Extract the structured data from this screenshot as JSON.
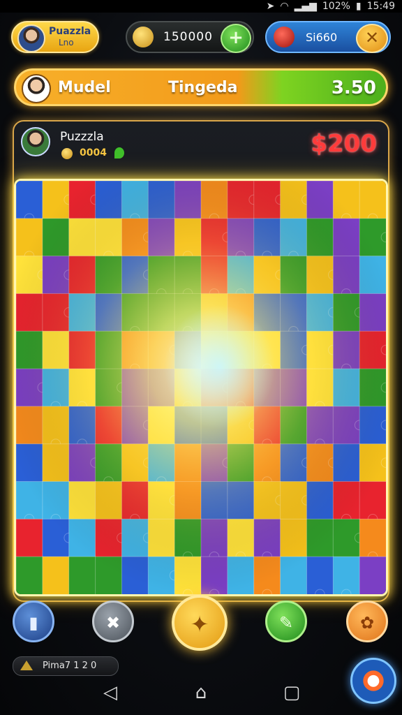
{
  "status_bar": {
    "icons": [
      "navigation-arrow-icon",
      "wifi-icon",
      "signal-icon"
    ],
    "battery": "102%",
    "time": "15:49"
  },
  "hud": {
    "profile": {
      "name": "Puazzla",
      "level": "Lno"
    },
    "coins": {
      "value": "150000",
      "add_label": "+"
    },
    "gems": {
      "value": "Si660",
      "close_label": "✕"
    }
  },
  "opponent_bar": {
    "name": "Mudel",
    "center_label": "Tingeda",
    "score": "3.50"
  },
  "board_header": {
    "player_name": "Puzzzla",
    "player_coins": "0004",
    "prize": "$200"
  },
  "puzzle": {
    "rows": 11,
    "cols": 14,
    "palette": [
      "#e8232e",
      "#f5c11b",
      "#2e9a2a",
      "#2a5fd6",
      "#f58a1c",
      "#7b3fc4",
      "#3fb3e6",
      "#ffe23a"
    ]
  },
  "actions": {
    "trash_label": "▮",
    "shuffle_label": "✖",
    "hint_label": "✦",
    "edit_label": "✎",
    "settings_label": "✿"
  },
  "ticker": {
    "text": "Pima7 1 2 0"
  },
  "nav": {
    "back": "◁",
    "home": "⌂",
    "recent": "▢"
  }
}
